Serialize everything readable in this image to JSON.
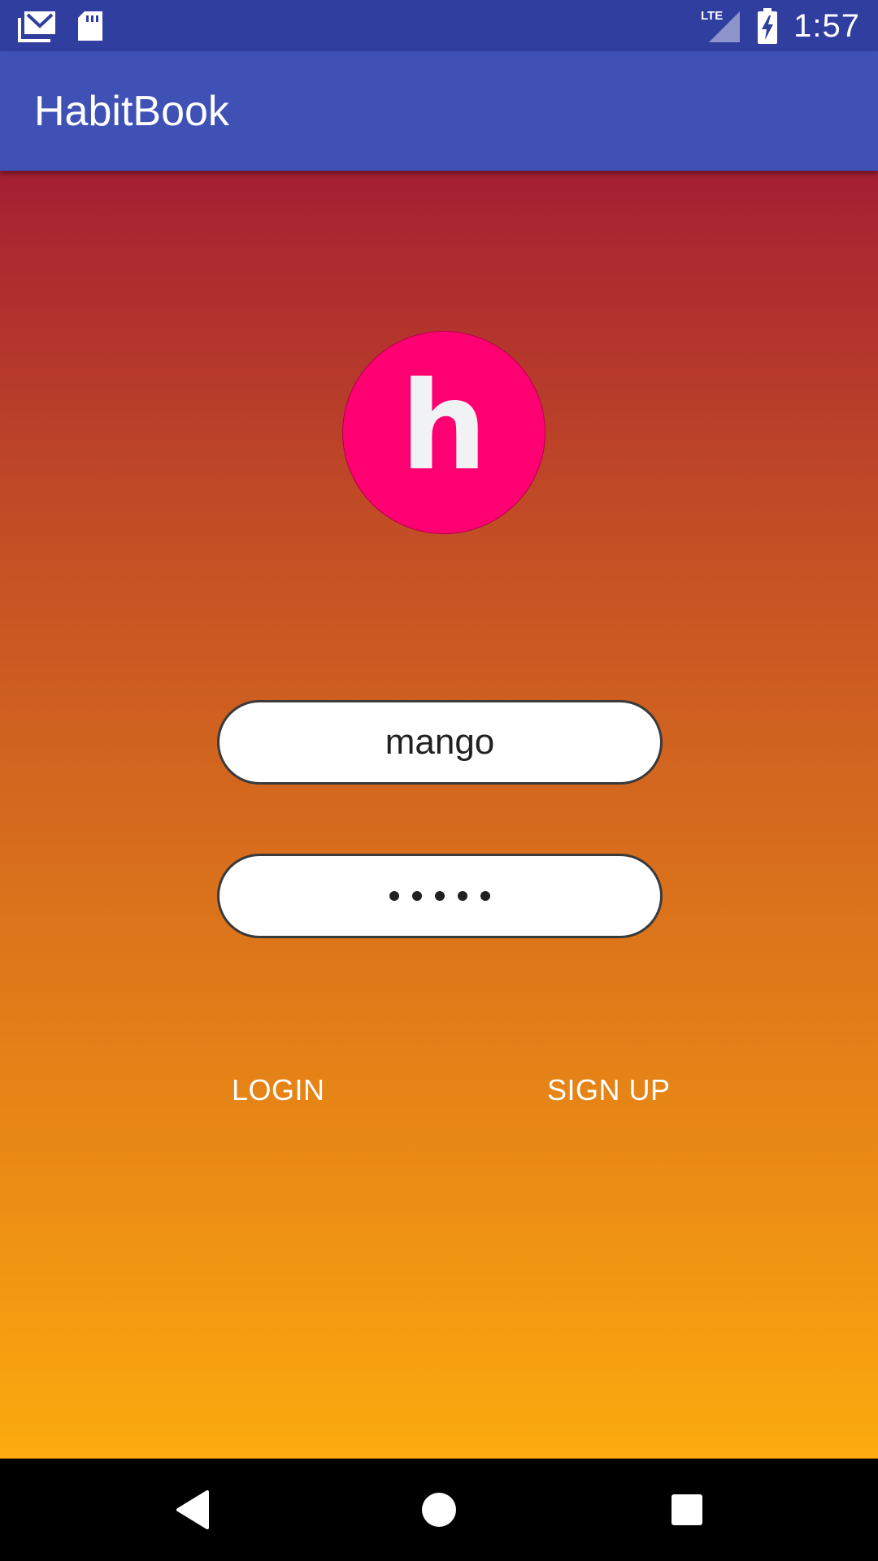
{
  "status_bar": {
    "time": "1:57",
    "network_label": "LTE",
    "icons": [
      "gmail-icon",
      "sd-card-icon",
      "lte-signal-icon",
      "battery-charging-icon"
    ]
  },
  "app_bar": {
    "title": "HabitBook"
  },
  "logo": {
    "letter": "h",
    "color": "#ff0073"
  },
  "login_form": {
    "username_value": "mango",
    "password_mask_length": 5
  },
  "buttons": {
    "login_label": "LOGIN",
    "signup_label": "SIGN UP"
  },
  "nav_bar": {
    "icons": [
      "back-icon",
      "home-icon",
      "recents-icon"
    ]
  },
  "colors": {
    "status_bar": "#303f9f",
    "app_bar": "#3f51b5",
    "gradient_top": "#a51f33",
    "gradient_bottom": "#fcab0e"
  }
}
